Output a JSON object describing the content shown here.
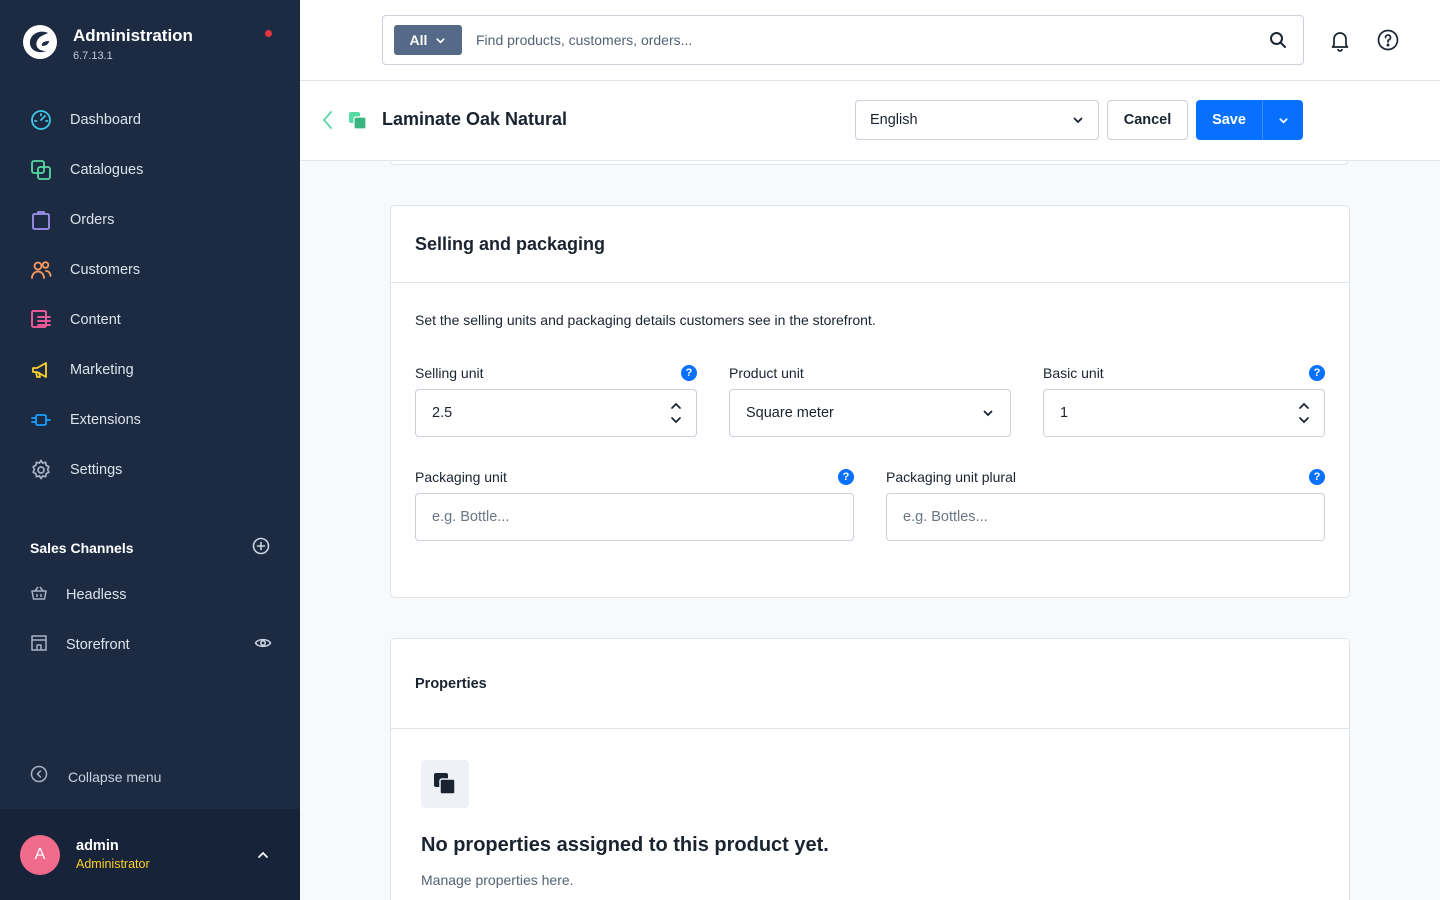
{
  "app": {
    "title": "Administration",
    "version": "6.7.13.1"
  },
  "sidebar": {
    "items": [
      {
        "label": "Dashboard",
        "icon": "dashboard-icon"
      },
      {
        "label": "Catalogues",
        "icon": "catalogue-icon"
      },
      {
        "label": "Orders",
        "icon": "shopping-bag-icon"
      },
      {
        "label": "Customers",
        "icon": "users-icon"
      },
      {
        "label": "Content",
        "icon": "content-icon"
      },
      {
        "label": "Marketing",
        "icon": "megaphone-icon"
      },
      {
        "label": "Extensions",
        "icon": "plug-icon"
      },
      {
        "label": "Settings",
        "icon": "gear-icon"
      }
    ],
    "sales_channels_title": "Sales Channels",
    "sales_channels": [
      {
        "label": "Headless",
        "icon": "basket-icon"
      },
      {
        "label": "Storefront",
        "icon": "storefront-icon"
      }
    ],
    "collapse_label": "Collapse menu",
    "user": {
      "initial": "A",
      "name": "admin",
      "role": "Administrator"
    }
  },
  "topbar": {
    "search_type": "All",
    "search_placeholder": "Find products, customers, orders..."
  },
  "smartbar": {
    "title": "Laminate Oak Natural",
    "language": "English",
    "cancel_label": "Cancel",
    "save_label": "Save"
  },
  "selling_card": {
    "title": "Selling and packaging",
    "description": "Set the selling units and packaging details customers see in the storefront.",
    "selling_unit": {
      "label": "Selling unit",
      "value": "2.5"
    },
    "product_unit": {
      "label": "Product unit",
      "value": "Square meter"
    },
    "basic_unit": {
      "label": "Basic unit",
      "value": "1"
    },
    "packaging_unit": {
      "label": "Packaging unit",
      "placeholder": "e.g. Bottle..."
    },
    "packaging_unit_plural": {
      "label": "Packaging unit plural",
      "placeholder": "e.g. Bottles..."
    },
    "help_glyph": "?"
  },
  "properties_card": {
    "title": "Properties",
    "empty_title": "No properties assigned to this product yet.",
    "empty_subtitle": "Manage properties here."
  },
  "colors": {
    "sidebar_bg": "#1c2b42",
    "accent": "#0870ff",
    "notification_dot": "#e5373f",
    "role_text": "#ffd02b",
    "avatar": "#f06a8c"
  }
}
